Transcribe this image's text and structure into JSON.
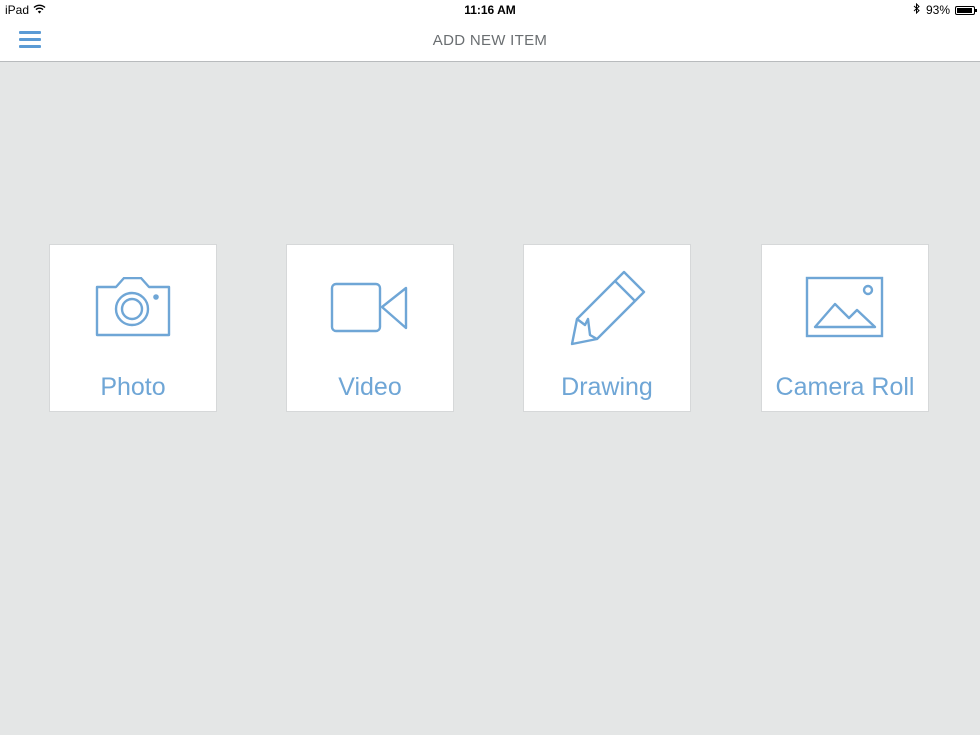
{
  "status_bar": {
    "device": "iPad",
    "time": "11:16 AM",
    "battery": "93%",
    "battery_level": 0.93
  },
  "nav": {
    "title": "ADD NEW ITEM",
    "menu_icon": "hamburger-menu-icon"
  },
  "colors": {
    "accent": "#6fa6d6",
    "background": "#e4e6e6",
    "tile": "#ffffff"
  },
  "options": [
    {
      "label": "Photo",
      "icon": "camera-icon"
    },
    {
      "label": "Video",
      "icon": "video-camera-icon"
    },
    {
      "label": "Drawing",
      "icon": "pencil-icon"
    },
    {
      "label": "Camera Roll",
      "icon": "image-icon"
    }
  ]
}
